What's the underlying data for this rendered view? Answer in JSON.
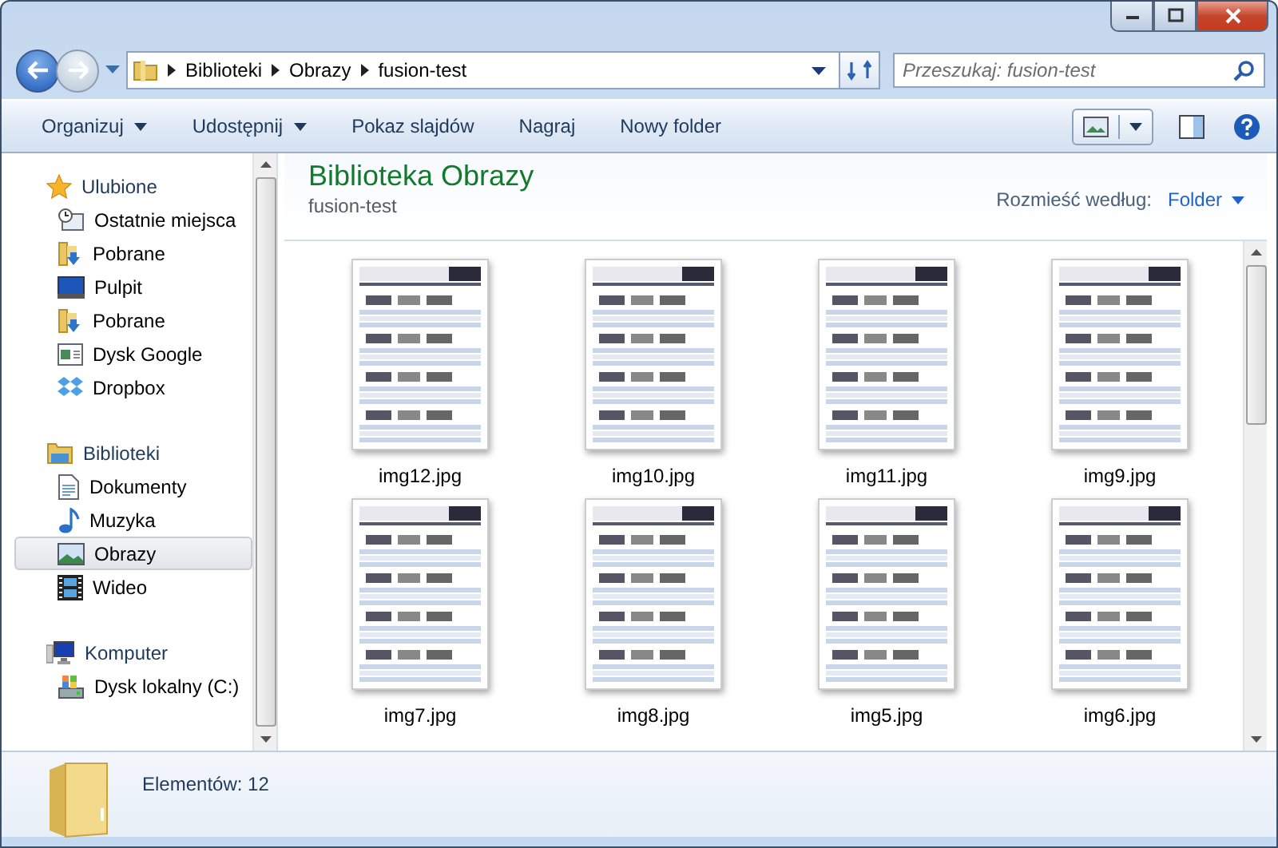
{
  "breadcrumb": [
    "Biblioteki",
    "Obrazy",
    "fusion-test"
  ],
  "search": {
    "placeholder": "Przeszukaj: fusion-test"
  },
  "toolbar": [
    {
      "label": "Organizuj",
      "dropdown": true
    },
    {
      "label": "Udostępnij",
      "dropdown": true
    },
    {
      "label": "Pokaz slajdów",
      "dropdown": false
    },
    {
      "label": "Nagraj",
      "dropdown": false
    },
    {
      "label": "Nowy folder",
      "dropdown": false
    }
  ],
  "sidebar": [
    {
      "label": "Ulubione",
      "kind": "star",
      "children": [
        {
          "label": "Ostatnie miejsca",
          "kind": "recent",
          "selected": false
        },
        {
          "label": "Pobrane",
          "kind": "downloads",
          "selected": false
        },
        {
          "label": "Pulpit",
          "kind": "desktop",
          "selected": false
        },
        {
          "label": "Pobrane",
          "kind": "downloads",
          "selected": false
        },
        {
          "label": "Dysk Google",
          "kind": "window",
          "selected": false
        },
        {
          "label": "Dropbox",
          "kind": "dropbox",
          "selected": false
        }
      ]
    },
    {
      "label": "Biblioteki",
      "kind": "library",
      "children": [
        {
          "label": "Dokumenty",
          "kind": "document",
          "selected": false
        },
        {
          "label": "Muzyka",
          "kind": "music",
          "selected": false
        },
        {
          "label": "Obrazy",
          "kind": "picture",
          "selected": true
        },
        {
          "label": "Wideo",
          "kind": "video",
          "selected": false
        }
      ]
    },
    {
      "label": "Komputer",
      "kind": "computer",
      "children": [
        {
          "label": "Dysk lokalny (C:)",
          "kind": "drive",
          "selected": false
        }
      ]
    }
  ],
  "content": {
    "title": "Biblioteka Obrazy",
    "subtitle": "fusion-test",
    "arrange_label": "Rozmieść według:",
    "arrange_value": "Folder"
  },
  "files": [
    {
      "name": "img12.jpg"
    },
    {
      "name": "img10.jpg"
    },
    {
      "name": "img11.jpg"
    },
    {
      "name": "img9.jpg"
    },
    {
      "name": "img7.jpg"
    },
    {
      "name": "img8.jpg"
    },
    {
      "name": "img5.jpg"
    },
    {
      "name": "img6.jpg"
    }
  ],
  "status_bar": {
    "text": "Elementów: 12"
  }
}
